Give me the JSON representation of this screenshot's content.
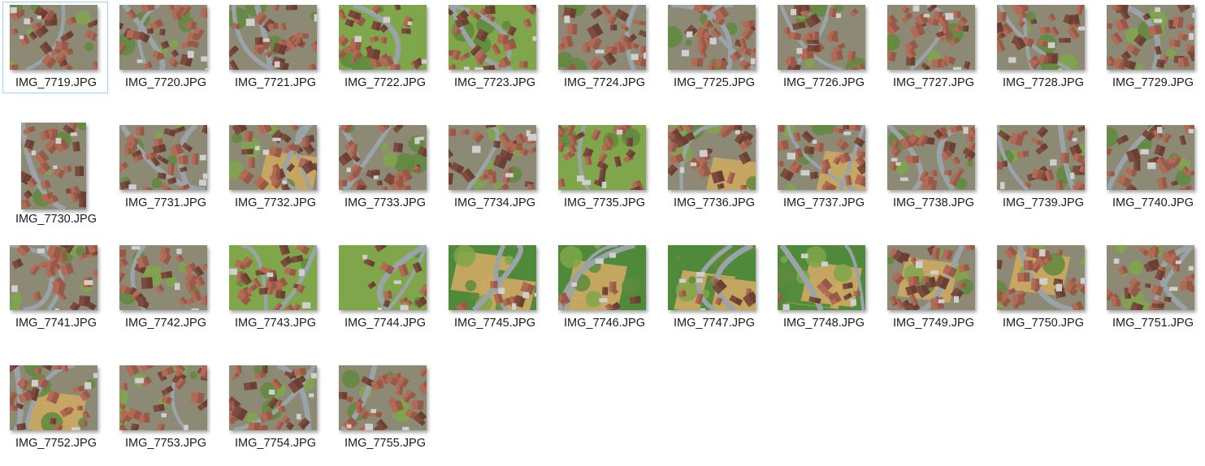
{
  "view": "large-icons",
  "files": [
    {
      "name": "IMG_7719.JPG",
      "selected": true,
      "orientation": "landscape",
      "scene": "village"
    },
    {
      "name": "IMG_7720.JPG",
      "orientation": "landscape",
      "scene": "village"
    },
    {
      "name": "IMG_7721.JPG",
      "orientation": "landscape",
      "scene": "village"
    },
    {
      "name": "IMG_7722.JPG",
      "orientation": "landscape",
      "scene": "village-green"
    },
    {
      "name": "IMG_7723.JPG",
      "orientation": "landscape",
      "scene": "village-green"
    },
    {
      "name": "IMG_7724.JPG",
      "orientation": "landscape",
      "scene": "village"
    },
    {
      "name": "IMG_7725.JPG",
      "orientation": "landscape",
      "scene": "village"
    },
    {
      "name": "IMG_7726.JPG",
      "orientation": "landscape",
      "scene": "village"
    },
    {
      "name": "IMG_7727.JPG",
      "orientation": "landscape",
      "scene": "village"
    },
    {
      "name": "IMG_7728.JPG",
      "orientation": "landscape",
      "scene": "village"
    },
    {
      "name": "IMG_7729.JPG",
      "orientation": "landscape",
      "scene": "village"
    },
    {
      "name": "IMG_7730.JPG",
      "orientation": "portrait",
      "scene": "village"
    },
    {
      "name": "IMG_7731.JPG",
      "orientation": "landscape",
      "scene": "village"
    },
    {
      "name": "IMG_7732.JPG",
      "orientation": "landscape",
      "scene": "village-field"
    },
    {
      "name": "IMG_7733.JPG",
      "orientation": "landscape",
      "scene": "village"
    },
    {
      "name": "IMG_7734.JPG",
      "orientation": "landscape",
      "scene": "village"
    },
    {
      "name": "IMG_7735.JPG",
      "orientation": "landscape",
      "scene": "village-green"
    },
    {
      "name": "IMG_7736.JPG",
      "orientation": "landscape",
      "scene": "village-field"
    },
    {
      "name": "IMG_7737.JPG",
      "orientation": "landscape",
      "scene": "village-field"
    },
    {
      "name": "IMG_7738.JPG",
      "orientation": "landscape",
      "scene": "village"
    },
    {
      "name": "IMG_7739.JPG",
      "orientation": "landscape",
      "scene": "village"
    },
    {
      "name": "IMG_7740.JPG",
      "orientation": "landscape",
      "scene": "village"
    },
    {
      "name": "IMG_7741.JPG",
      "orientation": "landscape",
      "scene": "village"
    },
    {
      "name": "IMG_7742.JPG",
      "orientation": "landscape",
      "scene": "village"
    },
    {
      "name": "IMG_7743.JPG",
      "orientation": "landscape",
      "scene": "village-green"
    },
    {
      "name": "IMG_7744.JPG",
      "orientation": "landscape",
      "scene": "green"
    },
    {
      "name": "IMG_7745.JPG",
      "orientation": "landscape",
      "scene": "fields"
    },
    {
      "name": "IMG_7746.JPG",
      "orientation": "landscape",
      "scene": "fields"
    },
    {
      "name": "IMG_7747.JPG",
      "orientation": "landscape",
      "scene": "fields"
    },
    {
      "name": "IMG_7748.JPG",
      "orientation": "landscape",
      "scene": "fields"
    },
    {
      "name": "IMG_7749.JPG",
      "orientation": "landscape",
      "scene": "village-field"
    },
    {
      "name": "IMG_7750.JPG",
      "orientation": "landscape",
      "scene": "village-field"
    },
    {
      "name": "IMG_7751.JPG",
      "orientation": "landscape",
      "scene": "village"
    },
    {
      "name": "IMG_7752.JPG",
      "orientation": "landscape",
      "scene": "village-field"
    },
    {
      "name": "IMG_7753.JPG",
      "orientation": "landscape",
      "scene": "village"
    },
    {
      "name": "IMG_7754.JPG",
      "orientation": "landscape",
      "scene": "village"
    },
    {
      "name": "IMG_7755.JPG",
      "orientation": "landscape",
      "scene": "village"
    }
  ],
  "colors": {
    "selection_border": "#99d1ff",
    "roof": "#b36a55",
    "roof_dark": "#7d4a3e",
    "road": "#9aa3a8",
    "grass": "#5f8a3d",
    "grass_light": "#7fa64a",
    "field_yellow": "#c9a862",
    "field_green": "#4f8a3a",
    "shadow": "#3a3a3a"
  }
}
